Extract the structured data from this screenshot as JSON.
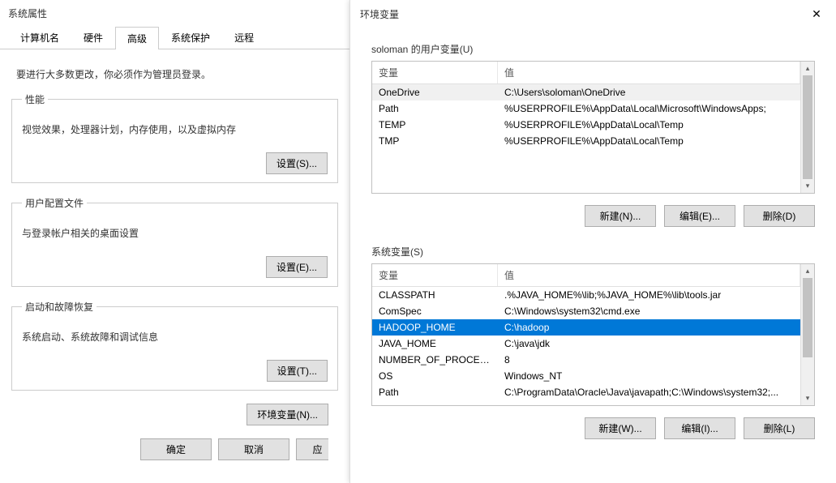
{
  "left": {
    "title": "系统属性",
    "tabs": [
      "计算机名",
      "硬件",
      "高级",
      "系统保护",
      "远程"
    ],
    "active_tab": 2,
    "hint": "要进行大多数更改，你必须作为管理员登录。",
    "groups": [
      {
        "legend": "性能",
        "text": "视觉效果，处理器计划，内存使用，以及虚拟内存",
        "btn": "设置(S)..."
      },
      {
        "legend": "用户配置文件",
        "text": "与登录帐户相关的桌面设置",
        "btn": "设置(E)..."
      },
      {
        "legend": "启动和故障恢复",
        "text": "系统启动、系统故障和调试信息",
        "btn": "设置(T)..."
      }
    ],
    "env_btn": "环境变量(N)...",
    "ok": "确定",
    "cancel": "取消",
    "apply_partial": "应"
  },
  "right": {
    "title": "环境变量",
    "user_label": "soloman 的用户变量(U)",
    "sys_label": "系统变量(S)",
    "col_var": "变量",
    "col_val": "值",
    "user_vars": [
      {
        "var": "OneDrive",
        "val": "C:\\Users\\soloman\\OneDrive"
      },
      {
        "var": "Path",
        "val": "%USERPROFILE%\\AppData\\Local\\Microsoft\\WindowsApps;"
      },
      {
        "var": "TEMP",
        "val": "%USERPROFILE%\\AppData\\Local\\Temp"
      },
      {
        "var": "TMP",
        "val": "%USERPROFILE%\\AppData\\Local\\Temp"
      }
    ],
    "sys_vars": [
      {
        "var": "CLASSPATH",
        "val": ".%JAVA_HOME%\\lib;%JAVA_HOME%\\lib\\tools.jar"
      },
      {
        "var": "ComSpec",
        "val": "C:\\Windows\\system32\\cmd.exe"
      },
      {
        "var": "HADOOP_HOME",
        "val": "C:\\hadoop"
      },
      {
        "var": "JAVA_HOME",
        "val": "C:\\java\\jdk"
      },
      {
        "var": "NUMBER_OF_PROCESSORS",
        "val": "8"
      },
      {
        "var": "OS",
        "val": "Windows_NT"
      },
      {
        "var": "Path",
        "val": "C:\\ProgramData\\Oracle\\Java\\javapath;C:\\Windows\\system32;..."
      }
    ],
    "sys_selected": 2,
    "new_u": "新建(N)...",
    "edit_u": "编辑(E)...",
    "del_u": "删除(D)",
    "new_s": "新建(W)...",
    "edit_s": "编辑(I)...",
    "del_s": "删除(L)"
  }
}
